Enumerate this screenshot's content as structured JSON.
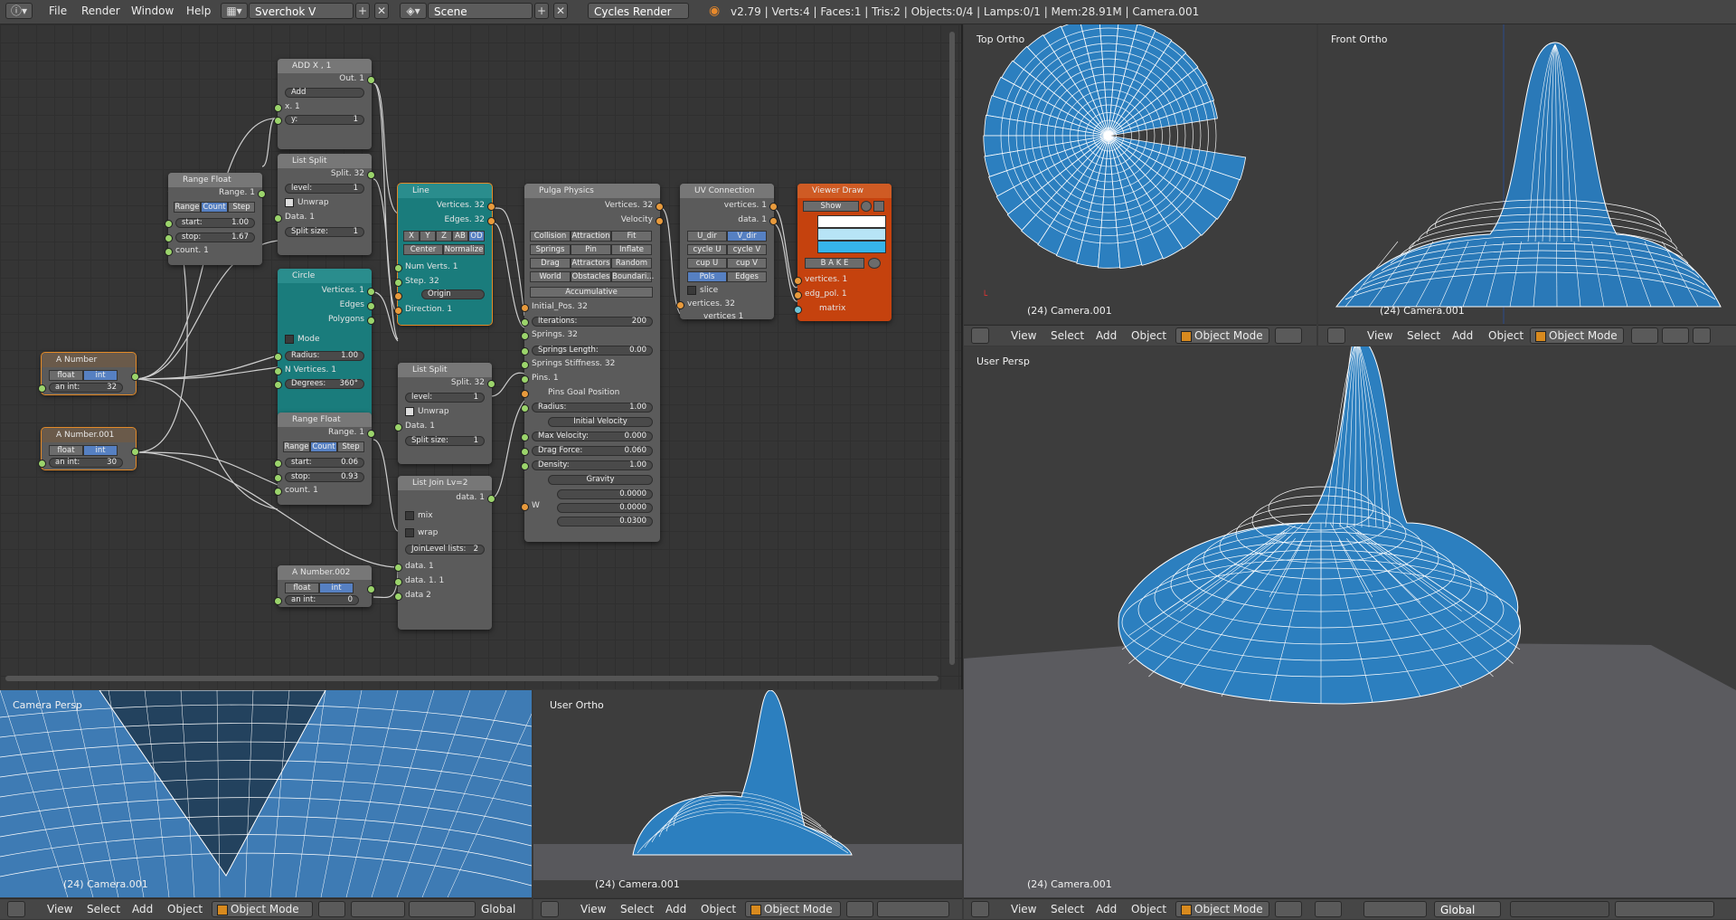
{
  "topbar": {
    "menu": [
      "File",
      "Render",
      "Window",
      "Help"
    ],
    "screen_layout": "Sverchok V",
    "scene": "Scene",
    "render_engine": "Cycles Render",
    "stats": "v2.79 | Verts:4 | Faces:1 | Tris:2 | Objects:0/4 | Lamps:0/1 | Mem:28.91M | Camera.001"
  },
  "nodes": {
    "add": {
      "title": "ADD X , 1",
      "out": "Out. 1",
      "op": "Add",
      "x": "x. 1",
      "y": "y:",
      "y_val": "1"
    },
    "list_split1": {
      "title": "List Split",
      "split": "Split. 32",
      "level": "level:",
      "level_val": "1",
      "unwrap": "Unwrap",
      "data": "Data. 1",
      "split_size": "Split size:",
      "split_size_val": "1"
    },
    "range_float1": {
      "title": "Range Float",
      "range": "Range. 1",
      "tabs": [
        "Range",
        "Count",
        "Step"
      ],
      "start": "start:",
      "start_val": "1.00",
      "stop": "stop:",
      "stop_val": "1.67",
      "count": "count. 1"
    },
    "line": {
      "title": "Line",
      "vertices": "Vertices. 32",
      "edges": "Edges. 32",
      "axes": [
        "X",
        "Y",
        "Z",
        "AB",
        "OD"
      ],
      "center": "Center",
      "normalize": "Normalize",
      "num_verts": "Num Verts. 1",
      "step": "Step. 32",
      "origin": "Origin",
      "direction": "Direction. 1"
    },
    "circle": {
      "title": "Circle",
      "vertices": "Vertices. 1",
      "edges": "Edges",
      "polygons": "Polygons",
      "mode": "Mode",
      "radius": "Radius:",
      "radius_val": "1.00",
      "nverts": "N Vertices. 1",
      "degrees": "Degrees:",
      "degrees_val": "360°"
    },
    "a_number": {
      "title": "A Number",
      "float": "float",
      "int": "int",
      "an_int": "an int:",
      "val": "32"
    },
    "a_number001": {
      "title": "A Number.001",
      "float": "float",
      "int": "int",
      "an_int": "an int:",
      "val": "30"
    },
    "a_number002": {
      "title": "A Number.002",
      "float": "float",
      "int": "int",
      "an_int": "an int:",
      "val": "0"
    },
    "range_float2": {
      "title": "Range Float",
      "range": "Range. 1",
      "tabs": [
        "Range",
        "Count",
        "Step"
      ],
      "start": "start:",
      "start_val": "0.06",
      "stop": "stop:",
      "stop_val": "0.93",
      "count": "count. 1"
    },
    "list_split2": {
      "title": "List Split",
      "split": "Split. 32",
      "level": "level:",
      "level_val": "1",
      "unwrap": "Unwrap",
      "data": "Data. 1",
      "split_size": "Split size:",
      "split_size_val": "1"
    },
    "list_join": {
      "title": "List Join Lv=2",
      "data": "data. 1",
      "mix": "mix",
      "wrap": "wrap",
      "join_level": "JoinLevel lists:",
      "join_level_val": "2",
      "in1": "data. 1",
      "in2": "data. 1. 1",
      "in3": "data 2"
    },
    "pulga": {
      "title": "Pulga Physics",
      "vertices": "Vertices. 32",
      "velocity": "Velocity",
      "grid": [
        "Collision",
        "Attraction",
        "Fit",
        "Springs",
        "Pin",
        "Inflate",
        "Drag",
        "Attractors",
        "Random",
        "World",
        "Obstacles",
        "Boundari..."
      ],
      "accumulative": "Accumulative",
      "initial_pos": "Initial_Pos. 32",
      "iterations": "Iterations:",
      "iterations_val": "200",
      "springs": "Springs. 32",
      "springs_length": "Springs Length:",
      "springs_length_val": "0.00",
      "springs_stiffness": "Springs Stiffness. 32",
      "pins": "Pins. 1",
      "pins_goal": "Pins Goal Position",
      "radius": "Radius:",
      "radius_val": "1.00",
      "initial_velocity": "Initial Velocity",
      "max_velocity": "Max Velocity:",
      "max_velocity_val": "0.000",
      "drag_force": "Drag Force:",
      "drag_force_val": "0.060",
      "density": "Density:",
      "density_val": "1.00",
      "gravity": "Gravity",
      "w": "W",
      "vec": [
        "0.0000",
        "0.0000",
        "0.0300"
      ]
    },
    "uv": {
      "title": "UV Connection",
      "vertices": "vertices. 1",
      "data": "data. 1",
      "tabs": [
        "U_dir",
        "V_dir",
        "cycle U",
        "cycle V",
        "cup U",
        "cup V",
        "Pols",
        "Edges"
      ],
      "slice": "slice",
      "in_vertices": "vertices. 32",
      "in_vertices2": "vertices 1"
    },
    "viewer": {
      "title": "Viewer Draw",
      "show": "Show",
      "bake": "B A K E",
      "vertices": "vertices. 1",
      "edg_pol": "edg_pol. 1",
      "matrix": "matrix"
    }
  },
  "viewports": {
    "top_ortho": {
      "label": "Top Ortho",
      "camera": "(24) Camera.001"
    },
    "front_ortho": {
      "label": "Front Ortho",
      "camera": "(24) Camera.001"
    },
    "user_persp": {
      "label": "User Persp",
      "camera": "(24) Camera.001"
    },
    "camera_persp": {
      "label": "Camera Persp",
      "camera": "(24) Camera.001"
    },
    "user_ortho": {
      "label": "User Ortho",
      "camera": "(24) Camera.001"
    }
  },
  "view_menu": {
    "view": "View",
    "select": "Select",
    "add": "Add",
    "object": "Object",
    "mode": "Object Mode",
    "orientation": "Global"
  },
  "colors": {
    "accent": "#5680c2",
    "teal_node": "#1a7c7c",
    "orange_node": "#c5420e",
    "mesh": "#2f80c4",
    "wire": "#ffffff"
  }
}
